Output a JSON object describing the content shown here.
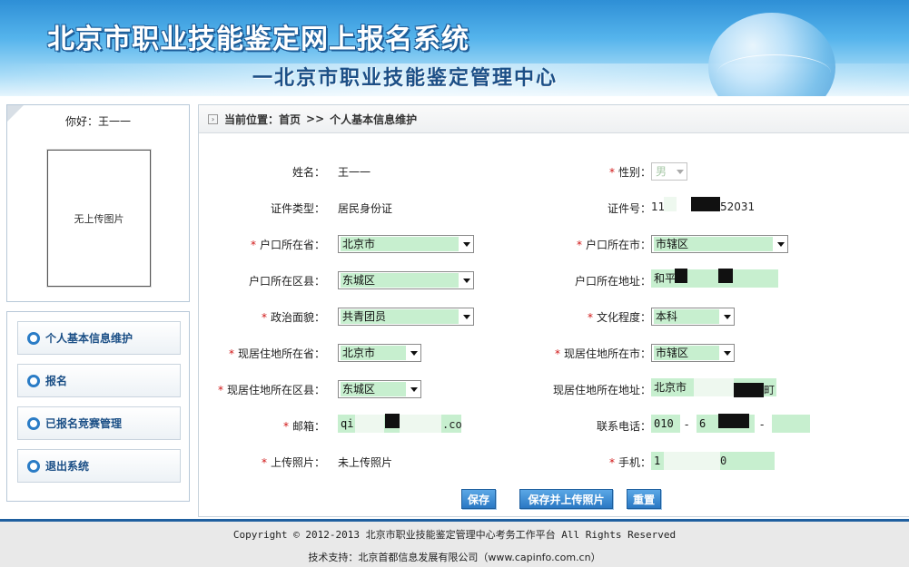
{
  "header": {
    "title": "北京市职业技能鉴定网上报名系统",
    "subtitle": "一北京市职业技能鉴定管理中心"
  },
  "sidebar": {
    "greeting": "你好：王一一",
    "photo_placeholder": "无上传图片",
    "menu": [
      {
        "label": "个人基本信息维护"
      },
      {
        "label": "报名"
      },
      {
        "label": "已报名竞赛管理"
      },
      {
        "label": "退出系统"
      }
    ]
  },
  "breadcrumb": {
    "prefix": "当前位置：",
    "home": "首页",
    "separator": ">>",
    "current": "个人基本信息维护"
  },
  "form": {
    "name_label": "姓名：",
    "name_value": "王一一",
    "gender_label": "性别：",
    "gender_value": "男",
    "id_type_label": "证件类型：",
    "id_type_value": "居民身份证",
    "id_no_label": "证件号：",
    "id_no_prefix": "11",
    "id_no_suffix": "52031",
    "hukou_province_label": "户口所在省：",
    "hukou_province_value": "北京市",
    "hukou_city_label": "户口所在市：",
    "hukou_city_value": "市辖区",
    "hukou_district_label": "户口所在区县：",
    "hukou_district_value": "东城区",
    "hukou_address_label": "户口所在地址：",
    "hukou_address_value": "和平",
    "political_label": "政治面貌：",
    "political_value": "共青团员",
    "education_label": "文化程度：",
    "education_value": "本科",
    "res_province_label": "现居住地所在省：",
    "res_province_value": "北京市",
    "res_city_label": "现居住地所在市：",
    "res_city_value": "市辖区",
    "res_district_label": "现居住地所在区县：",
    "res_district_value": "东城区",
    "res_address_label": "现居住地所在地址：",
    "res_address_value": "北京市",
    "res_address_tail": "町",
    "email_label": "邮箱：",
    "email_prefix": "qi",
    "email_suffix": ".co",
    "phone_label": "联系电话：",
    "phone_area": "010",
    "phone_dash": "-",
    "phone_number": "6",
    "phone_ext": "",
    "photo_label": "上传照片：",
    "photo_value": "未上传照片",
    "mobile_label": "手机：",
    "mobile_prefix": "1",
    "mobile_suffix": "0",
    "required_mark": "*"
  },
  "buttons": {
    "save": "保存",
    "save_upload": "保存并上传照片",
    "reset": "重置"
  },
  "footer": {
    "copyright": "Copyright © 2012-2013 北京市职业技能鉴定管理中心考务工作平台 All Rights Reserved",
    "tech_support": "技术支持：北京首都信息发展有限公司（www.capinfo.com.cn）"
  }
}
